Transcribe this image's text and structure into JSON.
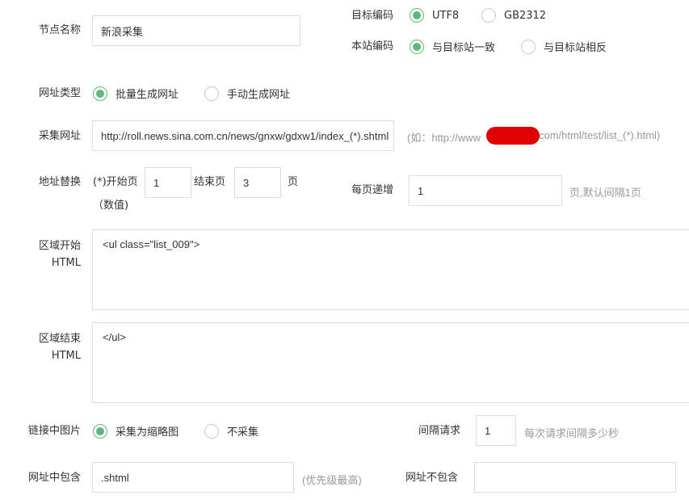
{
  "node_name": {
    "label": "节点名称",
    "value": "新浪采集"
  },
  "target_encoding": {
    "label": "目标编码",
    "options": [
      {
        "label": "UTF8",
        "checked": true
      },
      {
        "label": "GB2312",
        "checked": false
      }
    ]
  },
  "site_encoding": {
    "label": "本站编码",
    "options": [
      {
        "label": "与目标站一致",
        "checked": true
      },
      {
        "label": "与目标站相反",
        "checked": false
      }
    ]
  },
  "url_type": {
    "label": "网址类型",
    "options": [
      {
        "label": "批量生成网址",
        "checked": true
      },
      {
        "label": "手动生成网址",
        "checked": false
      }
    ]
  },
  "collect_url": {
    "label": "采集网址",
    "value": "http://roll.news.sina.com.cn/news/gnxw/gdxw1/index_(*).shtml",
    "hint_prefix": "(如：http://www",
    "hint_suffix": "com/html/test/list_(*).html)"
  },
  "address_replace": {
    "label": "地址替换",
    "start_label": "(*)开始页",
    "start_value": "1",
    "end_label": "结束页",
    "end_value": "3",
    "page_suffix": "页",
    "numeric_note": "（数值)"
  },
  "page_increment": {
    "label": "每页递增",
    "value": "1",
    "hint": "页,默认间隔1页"
  },
  "region_start": {
    "label_line1": "区域开始",
    "label_line2": "HTML",
    "value": "<ul class=\"list_009\">"
  },
  "region_end": {
    "label_line1": "区域结束",
    "label_line2": "HTML",
    "value": "</ul>"
  },
  "link_images": {
    "label": "链接中图片",
    "options": [
      {
        "label": "采集为缩略图",
        "checked": true
      },
      {
        "label": "不采集",
        "checked": false
      }
    ]
  },
  "interval": {
    "label": "间隔请求",
    "value": "1",
    "hint": "每次请求间隔多少秒"
  },
  "url_include": {
    "label": "网址中包含",
    "value": ".shtml",
    "hint": "(优先级最高)"
  },
  "url_exclude": {
    "label": "网址不包含",
    "value": ""
  },
  "colors": {
    "accent": "#5fb878",
    "border": "#dcdcdc",
    "hint": "#999999",
    "redaction": "#e00000"
  }
}
